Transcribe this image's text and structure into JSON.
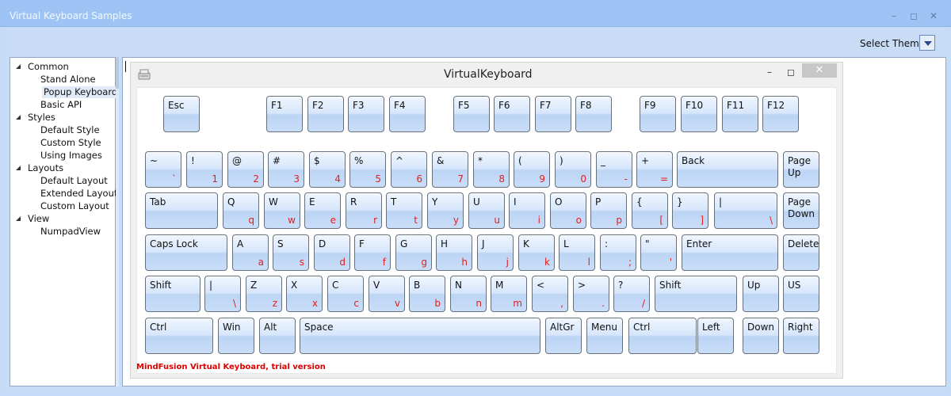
{
  "window": {
    "title": "Virtual Keyboard Samples",
    "minimize_glyph": "–",
    "maximize_glyph": "◻",
    "close_glyph": "✕"
  },
  "toolbar": {
    "select_theme_label": "Select Theme"
  },
  "tree": [
    {
      "label": "Common",
      "level": 0,
      "expanded": true
    },
    {
      "label": "Stand Alone",
      "level": 1
    },
    {
      "label": "Popup Keyboard",
      "level": 1,
      "selected": true
    },
    {
      "label": "Basic API",
      "level": 1
    },
    {
      "label": "Styles",
      "level": 0,
      "expanded": true
    },
    {
      "label": "Default Style",
      "level": 1
    },
    {
      "label": "Custom Style",
      "level": 1
    },
    {
      "label": "Using Images",
      "level": 1
    },
    {
      "label": "Layouts",
      "level": 0,
      "expanded": true
    },
    {
      "label": "Default Layout",
      "level": 1
    },
    {
      "label": "Extended Layout",
      "level": 1
    },
    {
      "label": "Custom Layout",
      "level": 1
    },
    {
      "label": "View",
      "level": 0,
      "expanded": true
    },
    {
      "label": "NumpadView",
      "level": 1
    }
  ],
  "keyboard_window": {
    "title": "VirtualKeyboard",
    "minimize_glyph": "–",
    "maximize_glyph": "◻",
    "close_glyph": "✕",
    "watermark": "MindFusion Virtual Keyboard, trial version"
  },
  "keyboard": {
    "rows": [
      [
        {
          "p": "Esc"
        },
        {
          "p": "F1"
        },
        {
          "p": "F2"
        },
        {
          "p": "F3"
        },
        {
          "p": "F4"
        },
        {
          "p": "F5"
        },
        {
          "p": "F6"
        },
        {
          "p": "F7"
        },
        {
          "p": "F8"
        },
        {
          "p": "F9"
        },
        {
          "p": "F10"
        },
        {
          "p": "F11"
        },
        {
          "p": "F12"
        }
      ],
      [
        {
          "p": "~",
          "s": "`"
        },
        {
          "p": "!",
          "s": "1"
        },
        {
          "p": "@",
          "s": "2"
        },
        {
          "p": "#",
          "s": "3"
        },
        {
          "p": "$",
          "s": "4"
        },
        {
          "p": "%",
          "s": "5"
        },
        {
          "p": "^",
          "s": "6"
        },
        {
          "p": "&",
          "s": "7"
        },
        {
          "p": "*",
          "s": "8"
        },
        {
          "p": "(",
          "s": "9"
        },
        {
          "p": ")",
          "s": "0"
        },
        {
          "p": "_",
          "s": "-"
        },
        {
          "p": "+",
          "s": "="
        },
        {
          "p": "Back"
        },
        {
          "p": "Page\nUp"
        }
      ],
      [
        {
          "p": "Tab"
        },
        {
          "p": "Q",
          "s": "q"
        },
        {
          "p": "W",
          "s": "w"
        },
        {
          "p": "E",
          "s": "e"
        },
        {
          "p": "R",
          "s": "r"
        },
        {
          "p": "T",
          "s": "t"
        },
        {
          "p": "Y",
          "s": "y"
        },
        {
          "p": "U",
          "s": "u"
        },
        {
          "p": "I",
          "s": "i"
        },
        {
          "p": "O",
          "s": "o"
        },
        {
          "p": "P",
          "s": "p"
        },
        {
          "p": "{",
          "s": "["
        },
        {
          "p": "}",
          "s": "]"
        },
        {
          "p": "|",
          "s": "\\"
        },
        {
          "p": "Page\nDown"
        }
      ],
      [
        {
          "p": "Caps Lock"
        },
        {
          "p": "A",
          "s": "a"
        },
        {
          "p": "S",
          "s": "s"
        },
        {
          "p": "D",
          "s": "d"
        },
        {
          "p": "F",
          "s": "f"
        },
        {
          "p": "G",
          "s": "g"
        },
        {
          "p": "H",
          "s": "h"
        },
        {
          "p": "J",
          "s": "j"
        },
        {
          "p": "K",
          "s": "k"
        },
        {
          "p": "L",
          "s": "l"
        },
        {
          "p": ":",
          "s": ";"
        },
        {
          "p": "\"",
          "s": "'"
        },
        {
          "p": "Enter"
        },
        {
          "p": "Delete"
        }
      ],
      [
        {
          "p": "Shift"
        },
        {
          "p": "|",
          "s": "\\"
        },
        {
          "p": "Z",
          "s": "z"
        },
        {
          "p": "X",
          "s": "x"
        },
        {
          "p": "C",
          "s": "c"
        },
        {
          "p": "V",
          "s": "v"
        },
        {
          "p": "B",
          "s": "b"
        },
        {
          "p": "N",
          "s": "n"
        },
        {
          "p": "M",
          "s": "m"
        },
        {
          "p": "<",
          "s": ","
        },
        {
          "p": ">",
          "s": "."
        },
        {
          "p": "?",
          "s": "/"
        },
        {
          "p": "Shift"
        },
        {
          "p": "Up"
        },
        {
          "p": "US"
        }
      ],
      [
        {
          "p": "Ctrl"
        },
        {
          "p": "Win"
        },
        {
          "p": "Alt"
        },
        {
          "p": "Space"
        },
        {
          "p": "AltGr"
        },
        {
          "p": "Menu"
        },
        {
          "p": "Ctrl"
        },
        {
          "p": "Left"
        },
        {
          "p": "Down"
        },
        {
          "p": "Right"
        }
      ]
    ]
  },
  "colors": {
    "title_bar": "#9dc4f4",
    "frame": "#c5dcf8",
    "secondary_label": "#e02020",
    "watermark": "#e00000"
  }
}
